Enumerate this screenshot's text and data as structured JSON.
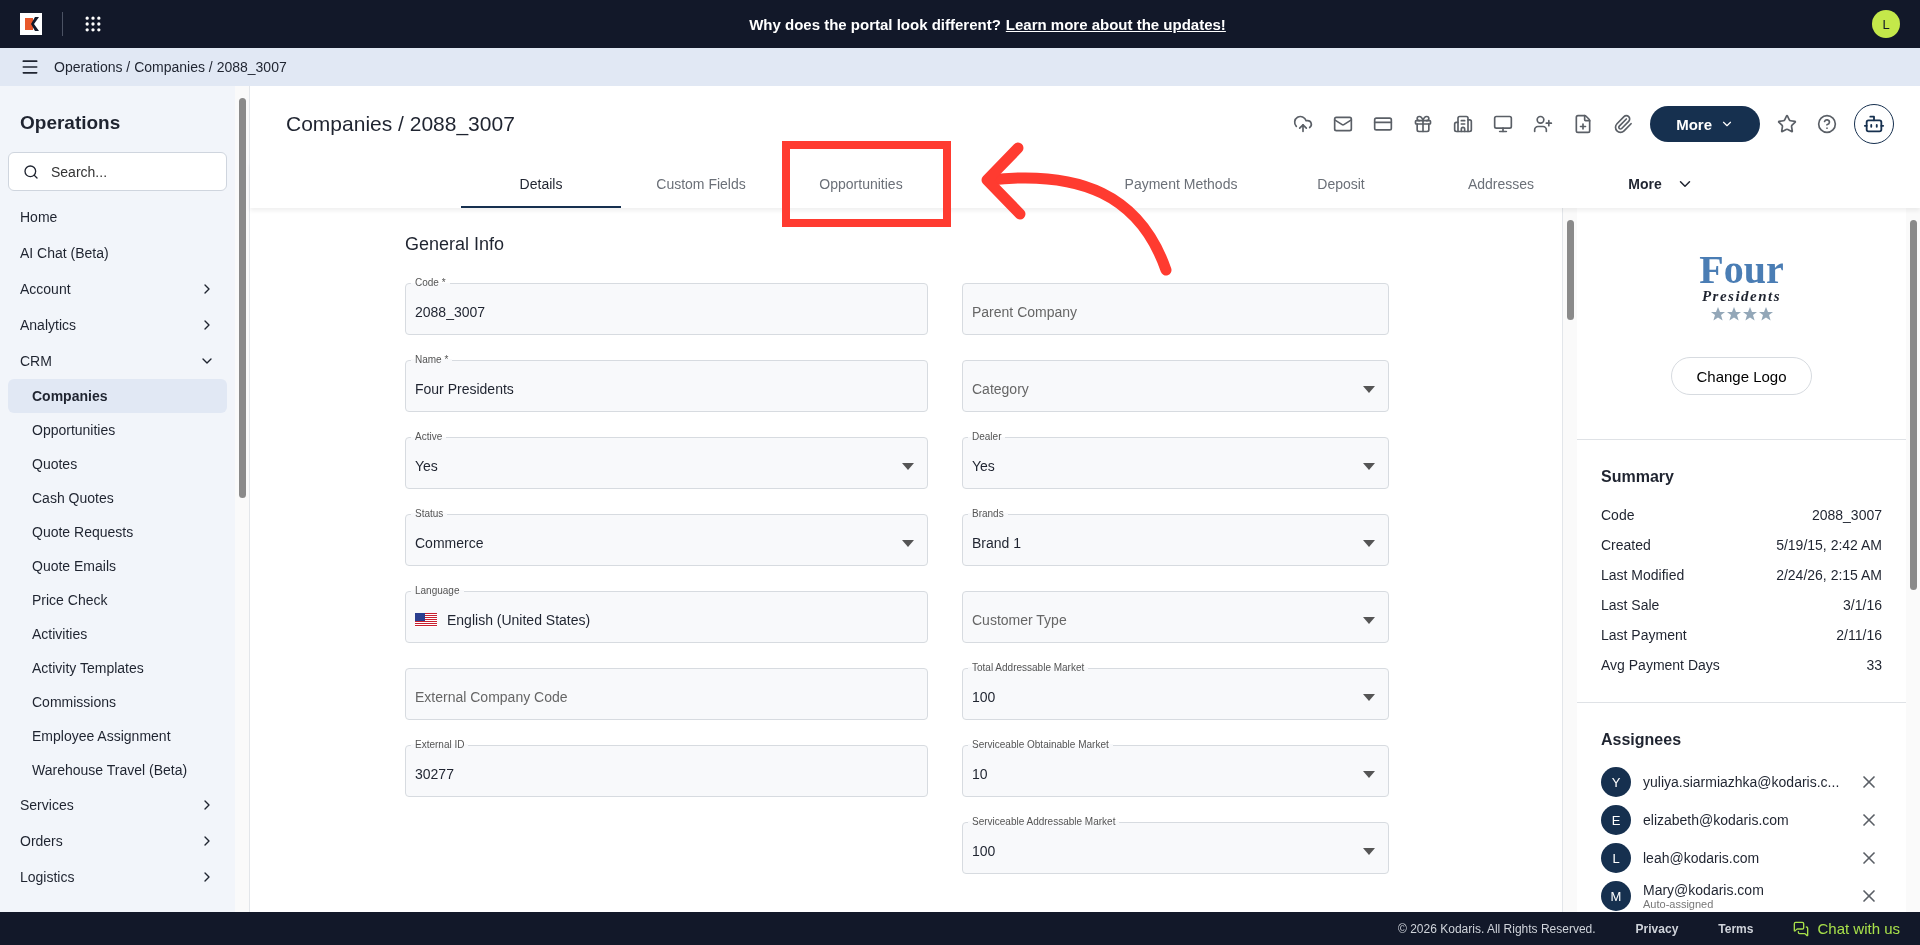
{
  "top_bar": {
    "announcement": "Why does the portal look different?",
    "announcement_link": "Learn more about the updates!",
    "avatar": "L"
  },
  "breadcrumb": "Operations / Companies / 2088_3007",
  "sidebar": {
    "title": "Operations",
    "search": {
      "placeholder": "Search..."
    },
    "items": [
      {
        "label": "Home",
        "kind": "link"
      },
      {
        "label": "AI Chat (Beta)",
        "kind": "link"
      },
      {
        "label": "Account",
        "kind": "group",
        "expanded": false
      },
      {
        "label": "Analytics",
        "kind": "group",
        "expanded": false
      },
      {
        "label": "CRM",
        "kind": "group",
        "expanded": true,
        "children": [
          {
            "label": "Companies",
            "selected": true
          },
          {
            "label": "Opportunities",
            "selected": false
          },
          {
            "label": "Quotes",
            "selected": false
          },
          {
            "label": "Cash Quotes",
            "selected": false
          },
          {
            "label": "Quote Requests",
            "selected": false
          },
          {
            "label": "Quote Emails",
            "selected": false
          },
          {
            "label": "Price Check",
            "selected": false
          },
          {
            "label": "Activities",
            "selected": false
          },
          {
            "label": "Activity Templates",
            "selected": false
          },
          {
            "label": "Commissions",
            "selected": false
          },
          {
            "label": "Employee Assignment",
            "selected": false
          },
          {
            "label": "Warehouse Travel (Beta)",
            "selected": false
          }
        ]
      },
      {
        "label": "Services",
        "kind": "group",
        "expanded": false
      },
      {
        "label": "Orders",
        "kind": "group",
        "expanded": false
      },
      {
        "label": "Logistics",
        "kind": "group",
        "expanded": false
      }
    ]
  },
  "page": {
    "title": "Companies / 2088_3007",
    "more_button": "More"
  },
  "tabs": [
    {
      "label": "Details",
      "selected": true,
      "kind": "tab"
    },
    {
      "label": "Custom Fields",
      "selected": false,
      "kind": "tab"
    },
    {
      "label": "Opportunities",
      "selected": false,
      "kind": "tab"
    },
    {
      "kind": "covered"
    },
    {
      "label": "Payment Methods",
      "selected": false,
      "kind": "tab"
    },
    {
      "label": "Deposit",
      "selected": false,
      "kind": "tab"
    },
    {
      "label": "Addresses",
      "selected": false,
      "kind": "tab"
    },
    {
      "label": "More",
      "selected": false,
      "kind": "menu"
    }
  ],
  "form": {
    "title": "General Info",
    "left": [
      {
        "kind": "text",
        "label": "Code *",
        "value": "2088_3007"
      },
      {
        "kind": "text",
        "label": "Name *",
        "value": "Four Presidents"
      },
      {
        "kind": "select",
        "label": "Active",
        "value": "Yes"
      },
      {
        "kind": "select",
        "label": "Status",
        "value": "Commerce"
      },
      {
        "kind": "language",
        "label": "Language",
        "value": "English (United States)"
      },
      {
        "kind": "text",
        "placeholder": "External Company Code"
      },
      {
        "kind": "text",
        "label": "External ID",
        "value": "30277"
      }
    ],
    "right": [
      {
        "kind": "text",
        "placeholder": "Parent Company"
      },
      {
        "kind": "select",
        "placeholder": "Category"
      },
      {
        "kind": "select",
        "label": "Dealer",
        "value": "Yes"
      },
      {
        "kind": "select",
        "label": "Brands",
        "value": "Brand 1"
      },
      {
        "kind": "select",
        "placeholder": "Customer Type"
      },
      {
        "kind": "select",
        "label": "Total Addressable Market",
        "value": "100"
      },
      {
        "kind": "select",
        "label": "Serviceable Obtainable Market",
        "value": "10"
      },
      {
        "kind": "select",
        "label": "Serviceable Addressable Market",
        "value": "100"
      }
    ]
  },
  "side_panel": {
    "logo": {
      "line1": "Four",
      "line2": "Presidents"
    },
    "change_logo": "Change Logo",
    "summary": {
      "title": "Summary",
      "rows": [
        {
          "label": "Code",
          "value": "2088_3007"
        },
        {
          "label": "Created",
          "value": "5/19/15, 2:42 AM"
        },
        {
          "label": "Last Modified",
          "value": "2/24/26, 2:15 AM"
        },
        {
          "label": "Last Sale",
          "value": "3/1/16"
        },
        {
          "label": "Last Payment",
          "value": "2/11/16"
        },
        {
          "label": "Avg Payment Days",
          "value": "33"
        }
      ]
    },
    "assignees": {
      "title": "Assignees",
      "items": [
        {
          "initial": "Y",
          "email": "yuliya.siarmiazhka@kodaris.c..."
        },
        {
          "initial": "E",
          "email": "elizabeth@kodaris.com"
        },
        {
          "initial": "L",
          "email": "leah@kodaris.com"
        },
        {
          "initial": "M",
          "email": "Mary@kodaris.com",
          "note": "Auto-assigned"
        }
      ]
    }
  },
  "footer": {
    "copyright": "© 2026 Kodaris. All Rights Reserved.",
    "links": [
      "Privacy",
      "Terms"
    ],
    "chat": "Chat with us"
  }
}
